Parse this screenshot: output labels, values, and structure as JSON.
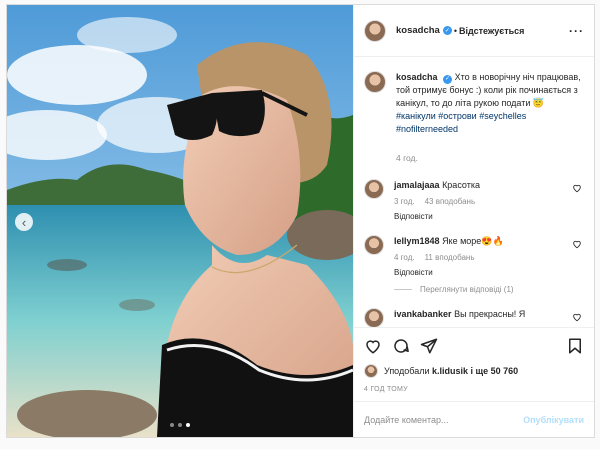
{
  "post": {
    "author": "kosadcha",
    "follow_label": "Відстежується",
    "caption_author": "kosadcha",
    "caption_text": "Хто в новорічну ніч працював, той отримує бонус :) коли рік починається з канікул, то до літа рукою подати 😇 ",
    "hashtags": "#канікули #острови #seychelles #nofilterneeded",
    "caption_time": "4 год.",
    "comments": [
      {
        "user": "jamalajaaa",
        "text": "Красотка",
        "time": "3 год.",
        "likes": "43 вподобань",
        "reply": "Відповісти"
      },
      {
        "user": "lellym1848",
        "text": "Яке море😍🔥",
        "time": "4 год.",
        "likes": "11 вподобань",
        "reply": "Відповісти",
        "view_replies": "Переглянути відповіді (1)"
      },
      {
        "user": "ivankabanker",
        "text": "Вы прекрасны! Я"
      }
    ],
    "liked_by_prefix": "Уподобали",
    "liked_by_user": "k.lidusik",
    "liked_by_suffix": "і ще 50 760",
    "time_ago": "4 ГОД ТОМУ",
    "comment_placeholder": "Додайте коментар...",
    "publish_label": "Опублікувати"
  },
  "icons": {
    "more": "more-icon",
    "like": "heart-icon",
    "comment": "comment-icon",
    "share": "share-icon",
    "save": "bookmark-icon",
    "prev": "chevron-left-icon"
  },
  "carousel": {
    "slides": 3,
    "active": 3
  },
  "colors": {
    "link": "#003569",
    "verified": "#3897f0",
    "muted": "#8e8e8e",
    "publish_disabled": "#b2dffc"
  }
}
